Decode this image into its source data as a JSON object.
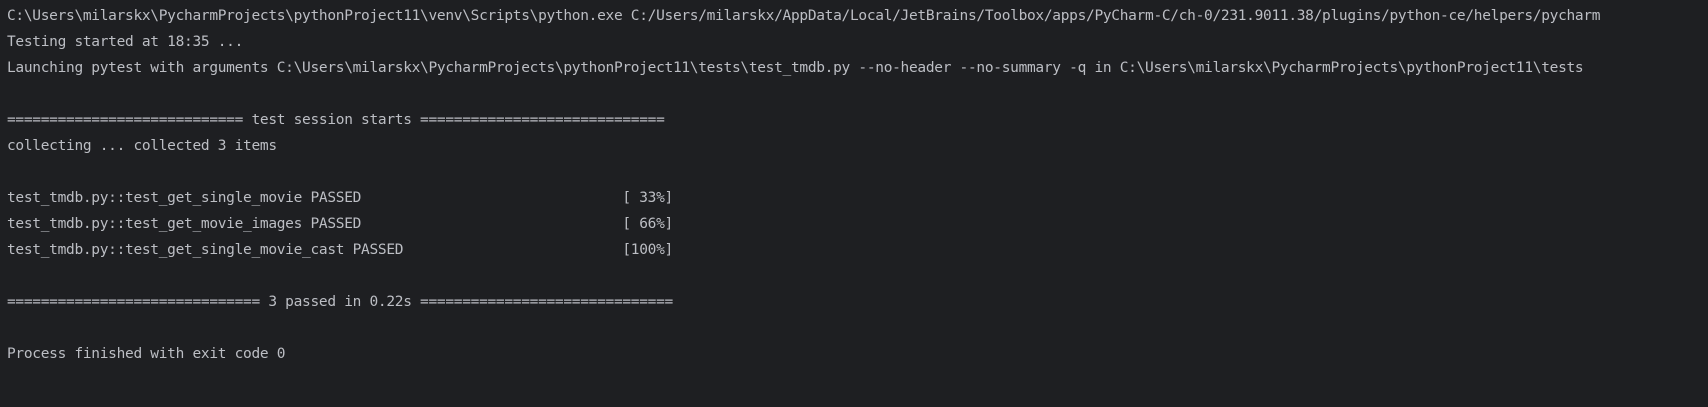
{
  "console": {
    "lines": [
      "C:\\Users\\milarskx\\PycharmProjects\\pythonProject11\\venv\\Scripts\\python.exe C:/Users/milarskx/AppData/Local/JetBrains/Toolbox/apps/PyCharm-C/ch-0/231.9011.38/plugins/python-ce/helpers/pycharm",
      "Testing started at 18:35 ...",
      "Launching pytest with arguments C:\\Users\\milarskx\\PycharmProjects\\pythonProject11\\tests\\test_tmdb.py --no-header --no-summary -q in C:\\Users\\milarskx\\PycharmProjects\\pythonProject11\\tests",
      "",
      "============================ test session starts =============================",
      "collecting ... collected 3 items",
      "",
      "test_tmdb.py::test_get_single_movie PASSED                               [ 33%]",
      "test_tmdb.py::test_get_movie_images PASSED                               [ 66%]",
      "test_tmdb.py::test_get_single_movie_cast PASSED                          [100%]",
      "",
      "============================== 3 passed in 0.22s ==============================",
      "",
      "Process finished with exit code 0"
    ]
  },
  "colors": {
    "background": "#1e1f22",
    "text": "#bcbec4"
  }
}
